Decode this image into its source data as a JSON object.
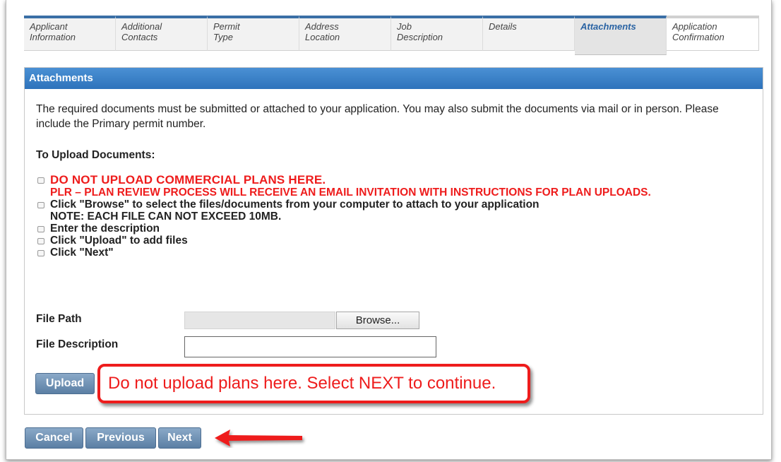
{
  "steps": [
    {
      "line1": "Applicant",
      "line2": "Information"
    },
    {
      "line1": "Additional",
      "line2": "Contacts"
    },
    {
      "line1": "Permit",
      "line2": "Type"
    },
    {
      "line1": "Address",
      "line2": "Location"
    },
    {
      "line1": "Job",
      "line2": "Description"
    },
    {
      "line1": "Details",
      "line2": ""
    },
    {
      "line1": "Attachments",
      "line2": ""
    },
    {
      "line1": "Application",
      "line2": "Confirmation"
    }
  ],
  "active_step": "Attachments",
  "panel": {
    "title": "Attachments",
    "intro": "The required documents must be submitted or attached to your application. You may also submit the documents via mail or in person. Please include the Primary permit number.",
    "upload_heading": "To Upload Documents:",
    "instructions": {
      "warning1": "DO NOT UPLOAD COMMERCIAL PLANS HERE.",
      "warning2": "PLR – PLAN REVIEW PROCESS WILL RECEIVE AN EMAIL INVITATION WITH INSTRUCTIONS FOR PLAN UPLOADS.",
      "browse": "Click \"Browse\" to select the files/documents from your computer to attach to your application",
      "note": "NOTE: EACH FILE CAN NOT EXCEED 10MB.",
      "describe": "Enter the description",
      "upload": "Click \"Upload\" to add files",
      "next": "Click \"Next\""
    },
    "file_path_label": "File Path",
    "browse_label": "Browse...",
    "file_description_label": "File Description",
    "file_description_value": "",
    "upload_label": "Upload"
  },
  "callout": "Do not upload plans here. Select NEXT to continue.",
  "nav": {
    "cancel": "Cancel",
    "previous": "Previous",
    "next": "Next"
  },
  "colors": {
    "header_blue": "#2e73bb",
    "warning_red": "#ee1c1c",
    "button_blue": "#5b7fa4"
  }
}
